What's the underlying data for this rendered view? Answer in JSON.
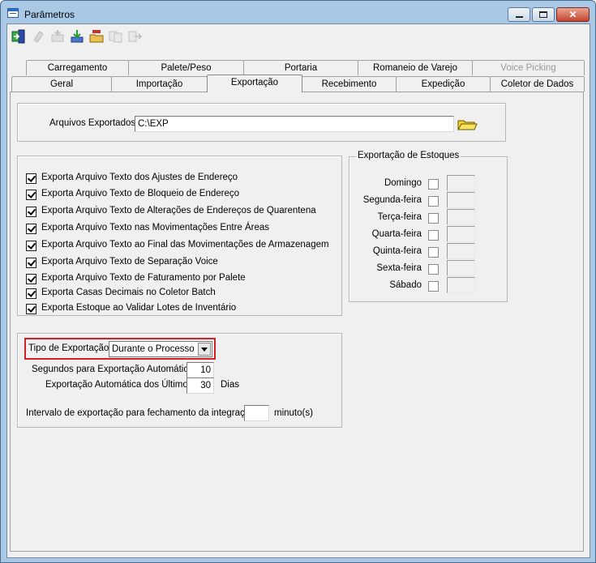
{
  "window": {
    "title": "Parâmetros"
  },
  "colors": {
    "highlight": "#d42027",
    "window_frame": "#a9c8e6",
    "client_bg": "#f0f0f0"
  },
  "toolbar": {
    "tools": [
      {
        "icon": "exit-door-icon",
        "enabled": true
      },
      {
        "icon": "eraser-icon",
        "enabled": false
      },
      {
        "icon": "add-record-icon",
        "enabled": false
      },
      {
        "icon": "save-download-icon",
        "enabled": true
      },
      {
        "icon": "open-folder-icon",
        "enabled": true
      },
      {
        "icon": "copy-icon",
        "enabled": false
      },
      {
        "icon": "export-arrow-icon",
        "enabled": false
      }
    ]
  },
  "tabs": {
    "row1": [
      {
        "label": "Carregamento",
        "enabled": true
      },
      {
        "label": "Palete/Peso",
        "enabled": true
      },
      {
        "label": "Portaria",
        "enabled": true
      },
      {
        "label": "Romaneio de Varejo",
        "enabled": true
      },
      {
        "label": "Voice Picking",
        "enabled": false
      }
    ],
    "row2": [
      {
        "label": "Geral",
        "enabled": true
      },
      {
        "label": "Importação",
        "enabled": true
      },
      {
        "label": "Exportação",
        "enabled": true,
        "active": true
      },
      {
        "label": "Recebimento",
        "enabled": true
      },
      {
        "label": "Expedição",
        "enabled": true
      },
      {
        "label": "Coletor de Dados",
        "enabled": true
      }
    ]
  },
  "export_files": {
    "label": "Arquivos Exportados",
    "value": "C:\\EXP"
  },
  "export_options": [
    {
      "label": "Exporta Arquivo Texto dos Ajustes de Endereço",
      "checked": true
    },
    {
      "label": "Exporta Arquivo Texto de Bloqueio de Endereço",
      "checked": true
    },
    {
      "label": "Exporta Arquivo Texto de Alterações de Endereços de Quarentena",
      "checked": true
    },
    {
      "label": "Exporta Arquivo Texto nas Movimentações Entre Áreas",
      "checked": true
    },
    {
      "label": "Exporta Arquivo Texto ao Final das Movimentações de Armazenagem",
      "checked": true
    },
    {
      "label": "Exporta Arquivo Texto de Separação Voice",
      "checked": true
    },
    {
      "label": "Exporta Arquivo Texto de Faturamento por Palete",
      "checked": true
    },
    {
      "label": "Exporta Casas Decimais no Coletor Batch",
      "checked": true
    },
    {
      "label": "Exporta Estoque ao Validar Lotes de Inventário",
      "checked": true
    }
  ],
  "stock_export": {
    "legend": "Exportação de Estoques",
    "days": [
      {
        "label": "Domingo",
        "checked": false,
        "time": ""
      },
      {
        "label": "Segunda-feira",
        "checked": false,
        "time": ""
      },
      {
        "label": "Terça-feira",
        "checked": false,
        "time": ""
      },
      {
        "label": "Quarta-feira",
        "checked": false,
        "time": ""
      },
      {
        "label": "Quinta-feira",
        "checked": false,
        "time": ""
      },
      {
        "label": "Sexta-feira",
        "checked": false,
        "time": ""
      },
      {
        "label": "Sábado",
        "checked": false,
        "time": ""
      }
    ]
  },
  "export_settings": {
    "type_label": "Tipo de Exportação",
    "type_value": "Durante o Processo",
    "auto_seconds_label": "Segundos para Exportação Automática",
    "auto_seconds_value": "10",
    "auto_days_label": "Exportação Automática dos Últimos",
    "auto_days_value": "30",
    "auto_days_unit": "Dias",
    "interval_label": "Intervalo de exportação para fechamento da integração",
    "interval_value": "",
    "interval_unit": "minuto(s)"
  }
}
